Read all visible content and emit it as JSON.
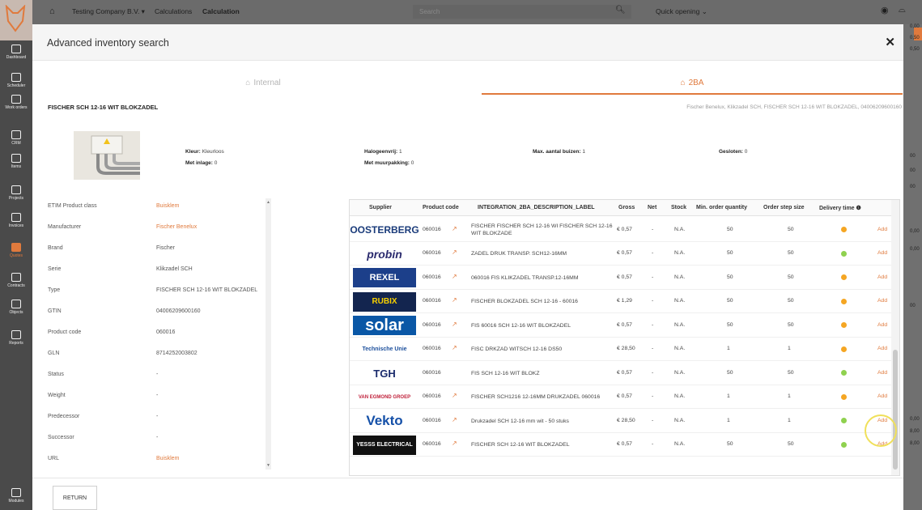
{
  "sidebar": {
    "items": [
      {
        "label": "Dashboard",
        "icon": "dashboard-icon",
        "active": false
      },
      {
        "label": "Scheduler",
        "icon": "calendar-icon",
        "active": false
      },
      {
        "label": "Work orders",
        "icon": "work-orders-icon",
        "active": false
      },
      {
        "label": "CRM",
        "icon": "crm-icon",
        "active": false
      },
      {
        "label": "Items",
        "icon": "items-icon",
        "active": false
      },
      {
        "label": "Projects",
        "icon": "projects-icon",
        "active": false
      },
      {
        "label": "Invoices",
        "icon": "invoices-icon",
        "active": false
      },
      {
        "label": "Quotes",
        "icon": "quotes-icon",
        "active": true
      },
      {
        "label": "Contracts",
        "icon": "contracts-icon",
        "active": false
      },
      {
        "label": "Objects",
        "icon": "objects-icon",
        "active": false
      },
      {
        "label": "Reports",
        "icon": "reports-icon",
        "active": false
      }
    ],
    "modules_label": "Modules"
  },
  "topbar": {
    "company": "Testing Company B.V. ▾",
    "crumb1": "Calculations",
    "crumb2": "Calculation",
    "search_placeholder": "Search",
    "quick": "Quick opening ⌄"
  },
  "rightstrip": [
    "0,00",
    "0,50",
    "0,50",
    "00",
    "00",
    "00",
    "0,00",
    "0,00",
    "00",
    "0,00",
    "8,00",
    "8,00"
  ],
  "modal": {
    "title": "Advanced inventory search",
    "tabs": {
      "internal": "Internal",
      "twoba": "2BA"
    },
    "product_title": "FISCHER SCH 12-16 WIT BLOKZADEL",
    "product_sub": "Fischer Benelux, Klikzadel SCH, FISCHER SCH 12-16 WIT BLOKZADEL, 04006209600160",
    "attrs": [
      {
        "k": "Kleur:",
        "v": "Kleurloos"
      },
      {
        "k": "Met inlage:",
        "v": "0"
      },
      {
        "k": "Halogeenvrij:",
        "v": "1"
      },
      {
        "k": "Met muurpakking:",
        "v": "0"
      },
      {
        "k": "Max. aantal buizen:",
        "v": "1"
      },
      {
        "k": "Gesloten:",
        "v": "0"
      }
    ],
    "details": [
      {
        "k": "ETIM Product class",
        "v": "Buisklem",
        "link": true
      },
      {
        "k": "Manufacturer",
        "v": "Fischer Benelux",
        "link": true
      },
      {
        "k": "Brand",
        "v": "Fischer",
        "link": false
      },
      {
        "k": "Serie",
        "v": "Klikzadel SCH",
        "link": false
      },
      {
        "k": "Type",
        "v": "FISCHER SCH 12-16 WIT BLOKZADEL",
        "link": false
      },
      {
        "k": "GTIN",
        "v": "04006209600160",
        "link": false
      },
      {
        "k": "Product code",
        "v": "060016",
        "link": false
      },
      {
        "k": "GLN",
        "v": "8714252003802",
        "link": false
      },
      {
        "k": "Status",
        "v": "-",
        "link": false
      },
      {
        "k": "Weight",
        "v": "-",
        "link": false
      },
      {
        "k": "Predecessor",
        "v": "-",
        "link": false
      },
      {
        "k": "Successor",
        "v": "-",
        "link": false
      },
      {
        "k": "URL",
        "v": "Buisklem",
        "link": true
      }
    ],
    "table": {
      "headers": [
        "Supplier",
        "Product code",
        "INTEGRATION_2BA_DESCRIPTION_LABEL",
        "Gross",
        "Net",
        "Stock",
        "Min. order quantity",
        "Order step size",
        "Delivery time ❶"
      ],
      "rows": [
        {
          "supplier": "OOSTERBERG",
          "code": "060016",
          "ext": true,
          "desc": "FISCHER FISCHER SCH 12-16 WI FISCHER SCH 12-16 WIT BLOKZADE",
          "gross": "€ 0,57",
          "net": "-",
          "stock": "N.A.",
          "min": "50",
          "step": "50",
          "status": "orange",
          "add": "Add"
        },
        {
          "supplier": "probin",
          "code": "060016",
          "ext": true,
          "desc": "ZADEL DRUK TRANSP. SCH12-16MM",
          "gross": "€ 0,57",
          "net": "-",
          "stock": "N.A.",
          "min": "50",
          "step": "50",
          "status": "green",
          "add": "Add"
        },
        {
          "supplier": "REXEL",
          "code": "060016",
          "ext": true,
          "desc": "060016 FIS KLIKZADEL TRANSP.12-16MM",
          "gross": "€ 0,57",
          "net": "-",
          "stock": "N.A.",
          "min": "50",
          "step": "50",
          "status": "orange",
          "add": "Add"
        },
        {
          "supplier": "RUBIX",
          "code": "060016",
          "ext": true,
          "desc": "FISCHER BLOKZADEL SCH 12-16 - 60016",
          "gross": "€ 1,29",
          "net": "-",
          "stock": "N.A.",
          "min": "50",
          "step": "50",
          "status": "orange",
          "add": "Add"
        },
        {
          "supplier": "solar",
          "code": "060016",
          "ext": true,
          "desc": "FIS 60016 SCH 12-16 WIT BLOKZADEL",
          "gross": "€ 0,57",
          "net": "-",
          "stock": "N.A.",
          "min": "50",
          "step": "50",
          "status": "orange",
          "add": "Add"
        },
        {
          "supplier": "Technische Unie",
          "code": "060016",
          "ext": true,
          "desc": "FISC DRKZAD WITSCH 12-16 DS50",
          "gross": "€ 28,50",
          "net": "-",
          "stock": "N.A.",
          "min": "1",
          "step": "1",
          "status": "orange",
          "add": "Add"
        },
        {
          "supplier": "TGH",
          "code": "060016",
          "ext": false,
          "desc": "FIS SCH 12-16 WIT BLOKZ",
          "gross": "€ 0,57",
          "net": "-",
          "stock": "N.A.",
          "min": "50",
          "step": "50",
          "status": "green",
          "add": "Add"
        },
        {
          "supplier": "VAN EGMOND GROEP",
          "code": "060016",
          "ext": true,
          "desc": "FISCHER SCH1216 12-16MM DRUKZADEL 060016",
          "gross": "€ 0,57",
          "net": "-",
          "stock": "N.A.",
          "min": "1",
          "step": "1",
          "status": "orange",
          "add": "Add"
        },
        {
          "supplier": "Vekto",
          "code": "060016",
          "ext": true,
          "desc": "Drukzadel SCH 12-16 mm wit - 50 stuks",
          "gross": "€ 28,50",
          "net": "-",
          "stock": "N.A.",
          "min": "1",
          "step": "1",
          "status": "green",
          "add": "Add"
        },
        {
          "supplier": "YESSS ELECTRICAL",
          "code": "060016",
          "ext": true,
          "desc": "FISCHER SCH 12-16 WIT BLOKZADEL",
          "gross": "€ 0,57",
          "net": "-",
          "stock": "N.A.",
          "min": "50",
          "step": "50",
          "status": "green",
          "add": "Add"
        }
      ]
    },
    "return_label": "RETURN"
  },
  "colors": {
    "accent": "#e07a3d",
    "status_orange": "#f5a623",
    "status_green": "#8fd14f"
  }
}
